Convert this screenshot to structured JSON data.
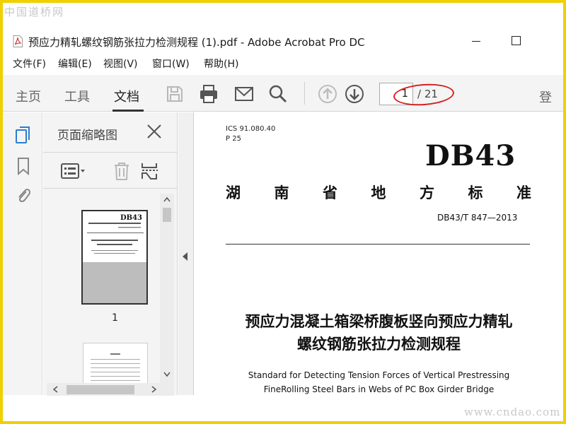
{
  "watermark": {
    "site_cn": "中国道桥网",
    "site_url": "www.cndao.com"
  },
  "window": {
    "title": "预应力精轧螺纹钢筋张拉力检测规程 (1).pdf - Adobe Acrobat Pro DC",
    "file_icon": "pdf-file-icon"
  },
  "menu": [
    {
      "label": "文件(F)"
    },
    {
      "label": "编辑(E)"
    },
    {
      "label": "视图(V)"
    },
    {
      "label": "窗口(W)"
    },
    {
      "label": "帮助(H)"
    }
  ],
  "toolbar": {
    "tabs": [
      {
        "label": "主页",
        "active": false
      },
      {
        "label": "工具",
        "active": false
      },
      {
        "label": "文档",
        "active": true
      }
    ],
    "icons": [
      "save-icon",
      "print-icon",
      "email-icon",
      "search-icon",
      "page-up-icon",
      "page-down-icon"
    ],
    "page_input_value": "1",
    "page_total": "/ 21",
    "sign_in": "登"
  },
  "left_rail": {
    "icons": [
      "page-thumbnails-icon",
      "bookmarks-icon",
      "attachments-icon"
    ],
    "active_color": "#2b7cd3"
  },
  "thumb_panel": {
    "title": "页面缩略图",
    "tools": [
      "thumbnail-options-icon",
      "delete-page-icon",
      "extract-page-icon"
    ],
    "thumbnails": [
      {
        "label": "1",
        "selected": true
      },
      {
        "label": "",
        "selected": false
      }
    ]
  },
  "document": {
    "ics": "ICS 91.080.40",
    "ccs": "P 25",
    "code": "DB43",
    "standard_name_chars": [
      "湖",
      "南",
      "省",
      "地",
      "方",
      "标",
      "准"
    ],
    "standard_number": "DB43/T 847—2013",
    "title_cn_line1": "预应力混凝土箱梁桥腹板竖向预应力精轧",
    "title_cn_line2": "螺纹钢筋张拉力检测规程",
    "title_en_line1": "Standard for Detecting Tension Forces of Vertical Prestressing",
    "title_en_line2": "FineRolling Steel Bars in Webs of PC Box Girder Bridge",
    "annotation_color": "#d62020"
  }
}
